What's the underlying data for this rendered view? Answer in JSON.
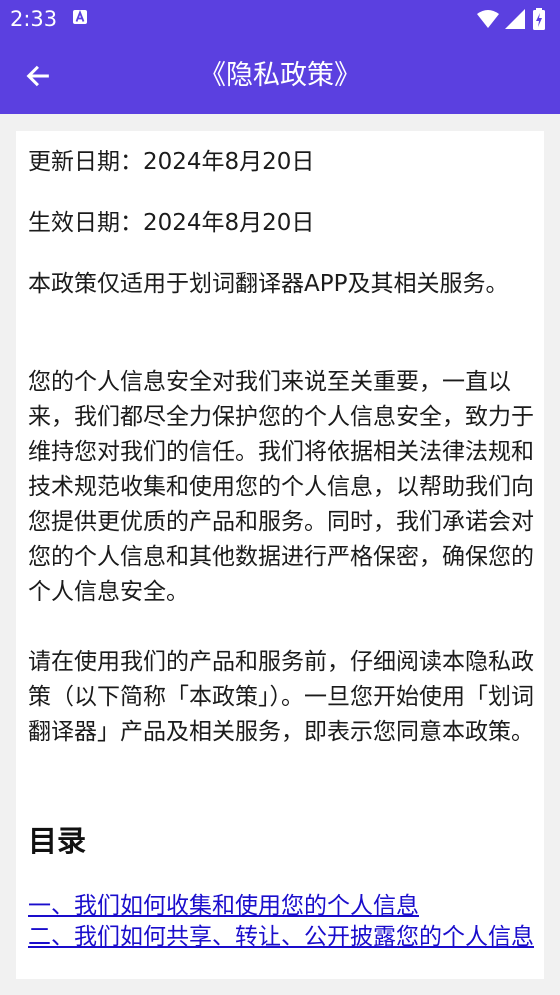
{
  "status_bar": {
    "time": "2:33",
    "icons": [
      "app-notification-icon",
      "wifi-icon",
      "signal-icon",
      "battery-icon"
    ]
  },
  "app_bar": {
    "title": "《隐私政策》",
    "back_icon": "arrow-left-icon",
    "color": "#5b40e0"
  },
  "content": {
    "update_date": "更新日期：2024年8月20日",
    "effective_date": "生效日期：2024年8月20日",
    "scope": "本政策仅适用于划词翻译器APP及其相关服务。",
    "intro": "您的个人信息安全对我们来说至关重要，一直以来，我们都尽全力保护您的个人信息安全，致力于维持您对我们的信任。我们将依据相关法律法规和技术规范收集和使用您的个人信息，以帮助我们向您提供更优质的产品和服务。同时，我们承诺会对您的个人信息和其他数据进行严格保密，确保您的个人信息安全。",
    "read_notice": "请在使用我们的产品和服务前，仔细阅读本隐私政策（以下简称「本政策」）。一旦您开始使用「划词翻译器」产品及相关服务，即表示您同意本政策。",
    "toc_heading": "目录",
    "toc": [
      "一、我们如何收集和使用您的个人信息",
      "二、我们如何共享、转让、公开披露您的个人信息"
    ]
  }
}
